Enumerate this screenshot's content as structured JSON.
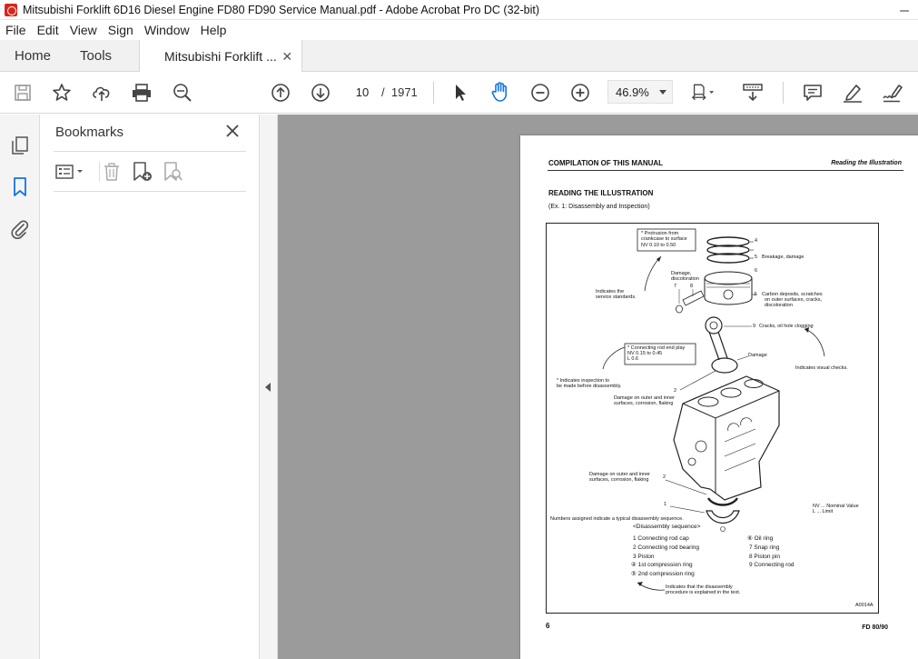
{
  "window": {
    "title": "Mitsubishi Forklift 6D16 Diesel Engine FD80 FD90 Service Manual.pdf - Adobe Acrobat Pro DC (32-bit)"
  },
  "menu": [
    "File",
    "Edit",
    "View",
    "Sign",
    "Window",
    "Help"
  ],
  "tabs": {
    "home": "Home",
    "tools": "Tools",
    "document": "Mitsubishi Forklift ..."
  },
  "toolbar": {
    "current_page": "10",
    "page_separator": "/",
    "total_pages": "1971",
    "zoom": "46.9%"
  },
  "bookmarks": {
    "title": "Bookmarks"
  },
  "document": {
    "header_left": "COMPILATION OF THIS MANUAL",
    "header_right": "Reading the Illustration",
    "section_title": "READING THE ILLUSTRATION",
    "example": "(Ex. 1:  Disassembly and Inspection)",
    "figure": {
      "box_top_1": "* Protrusion from",
      "box_top_2": "crankcase to surface",
      "box_top_3": "NV  0.10  to  0.50",
      "n4": "4",
      "n5": "5",
      "n6": "6",
      "breakage": "Breakage, damage",
      "damage_disc_1": "Damage,",
      "damage_disc_2": "discoloration",
      "n7": "7",
      "n8": "8",
      "n3": "3",
      "carbon_1": "Carbon deposits, scratches",
      "carbon_2": "on outer surfaces, cracks,",
      "carbon_3": "discoloration",
      "std_1": "Indicates the",
      "std_2": "service standards.",
      "n9": "9",
      "cracks": "Cracks, oil hole clogging",
      "box_mid_1": "* Connecting rod end play",
      "box_mid_2": "NV  0.15  to  0.45",
      "box_mid_3": "L      0.6",
      "damage": "Damage",
      "visual": "Indicates visual checks.",
      "insp_1": "* Indicates inspection to",
      "insp_2": "be made before disassembly.",
      "n2a": "2",
      "dmg_a_1": "Damage on outer and inner",
      "dmg_a_2": "surfaces, corrosion, flaking",
      "dmg_b_1": "Damage on outer and inner",
      "dmg_b_2": "surfaces, corrosion, flaking",
      "n2b": "2",
      "n1": "1",
      "nv_legend": "NV ... Nominal Value",
      "l_legend": "L  ...   Limit",
      "numbers_note": "Numbers assigned indicate a typical disassembly sequence.",
      "seq_title": "<Disassembly sequence>",
      "seq_left": [
        "1  Connecting rod cap",
        "2  Connecting rod bearing",
        "3  Piston",
        "④  1st compression ring",
        "⑤  2nd compression ring"
      ],
      "seq_right": [
        "⑥  Oil ring",
        "7  Snap ring",
        "8  Piston pin",
        "9  Connecting rod"
      ],
      "explained_1": "Indicates that the disassembly",
      "explained_2": "procedure is explained in the text.",
      "fig_code": "A0014A"
    },
    "footer_left": "6",
    "footer_right": "FD 80/90"
  }
}
